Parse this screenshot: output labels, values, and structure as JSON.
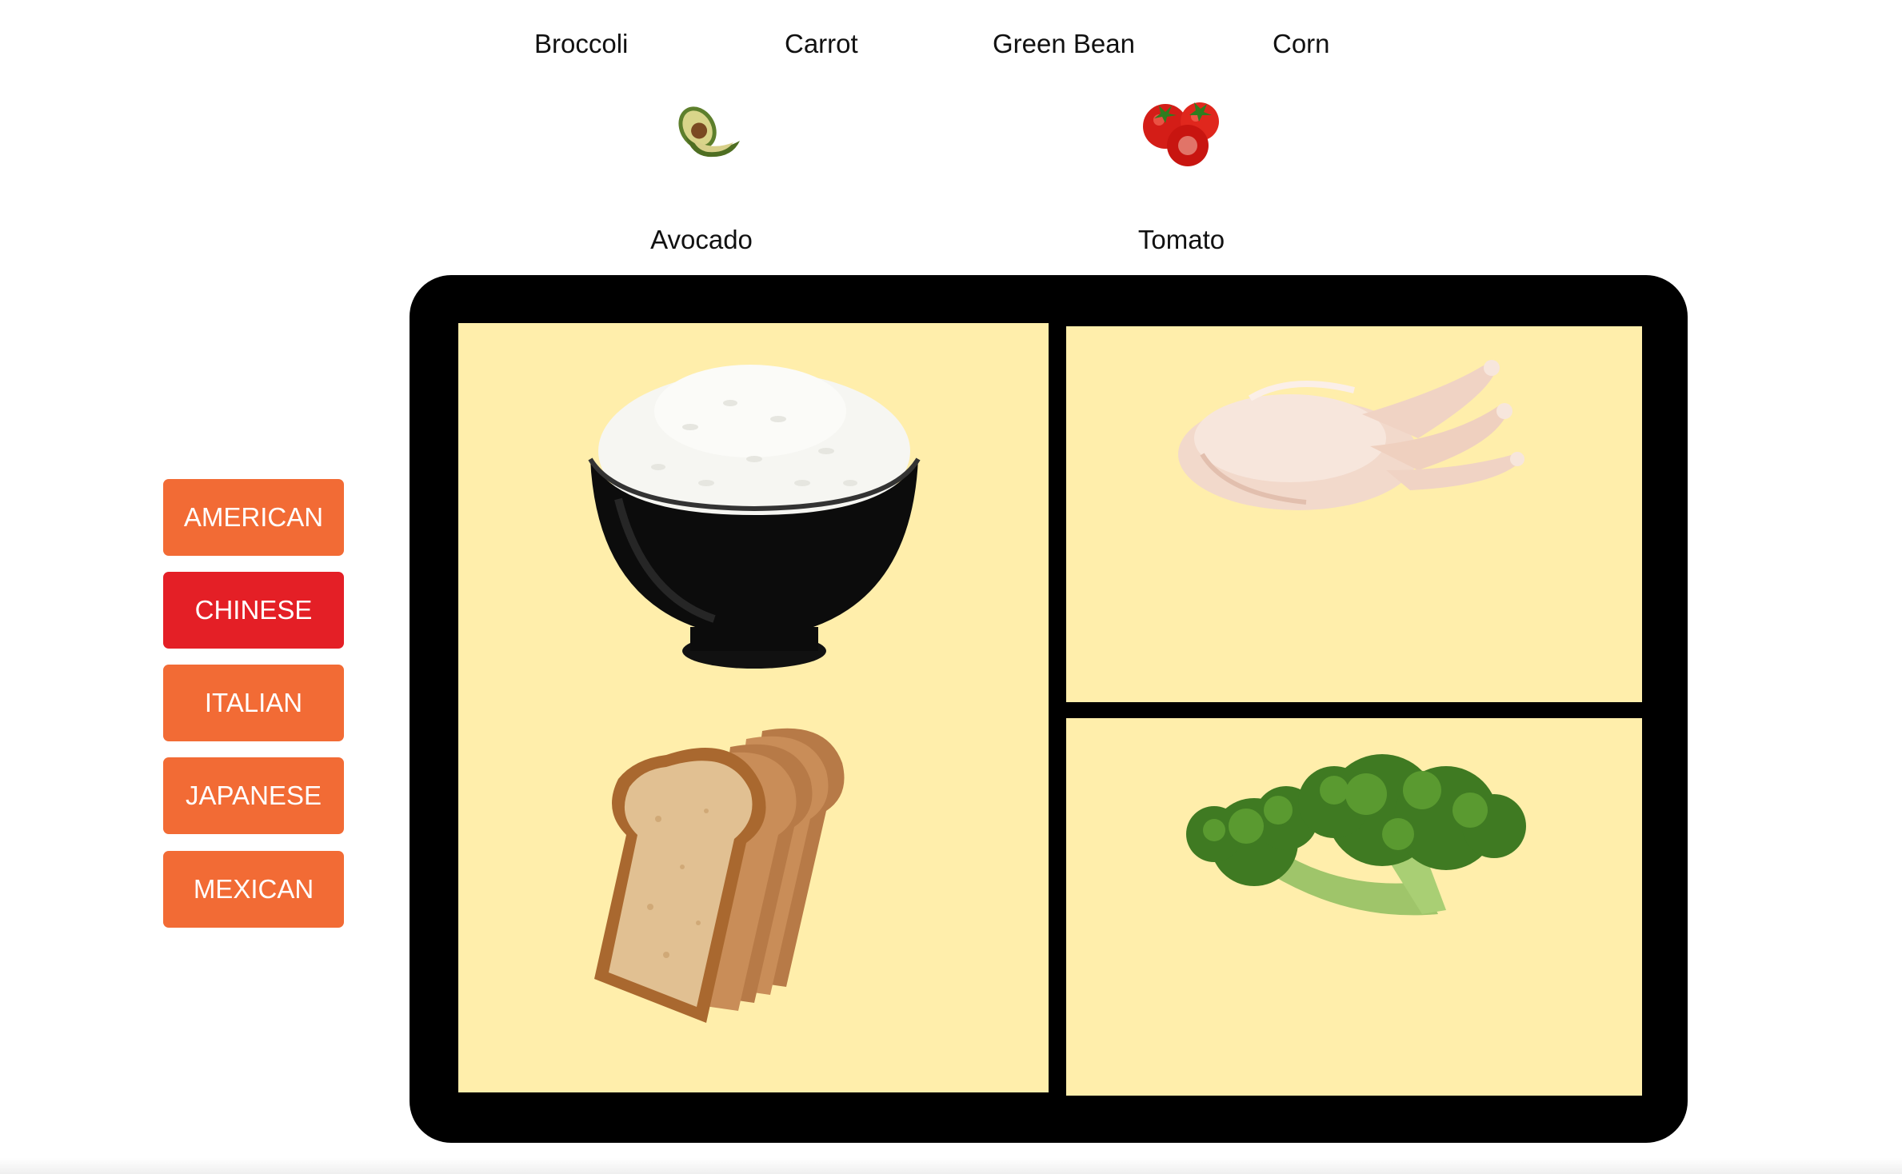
{
  "vegetables_top": [
    {
      "label": "Broccoli"
    },
    {
      "label": "Carrot"
    },
    {
      "label": "Green Bean"
    },
    {
      "label": "Corn"
    }
  ],
  "vegetables_pictured": [
    {
      "label": "Avocado",
      "icon": "avocado-icon"
    },
    {
      "label": "Tomato",
      "icon": "tomato-icon"
    }
  ],
  "cuisines": [
    {
      "label": "AMERICAN",
      "color": "#f26b35",
      "selected": false
    },
    {
      "label": "CHINESE",
      "color": "#e41f26",
      "selected": true
    },
    {
      "label": "ITALIAN",
      "color": "#f26b35",
      "selected": false
    },
    {
      "label": "JAPANESE",
      "color": "#f26b35",
      "selected": false
    },
    {
      "label": "MEXICAN",
      "color": "#f26b35",
      "selected": false
    }
  ],
  "tray": {
    "compartments": [
      {
        "name": "grains",
        "items": [
          "rice-bowl-image",
          "bread-slices-image"
        ]
      },
      {
        "name": "protein",
        "items": [
          "raw-chicken-image"
        ]
      },
      {
        "name": "vegetable",
        "items": [
          "broccoli-image"
        ]
      }
    ],
    "colors": {
      "frame": "#000000",
      "compartment": "#ffeeab"
    }
  }
}
